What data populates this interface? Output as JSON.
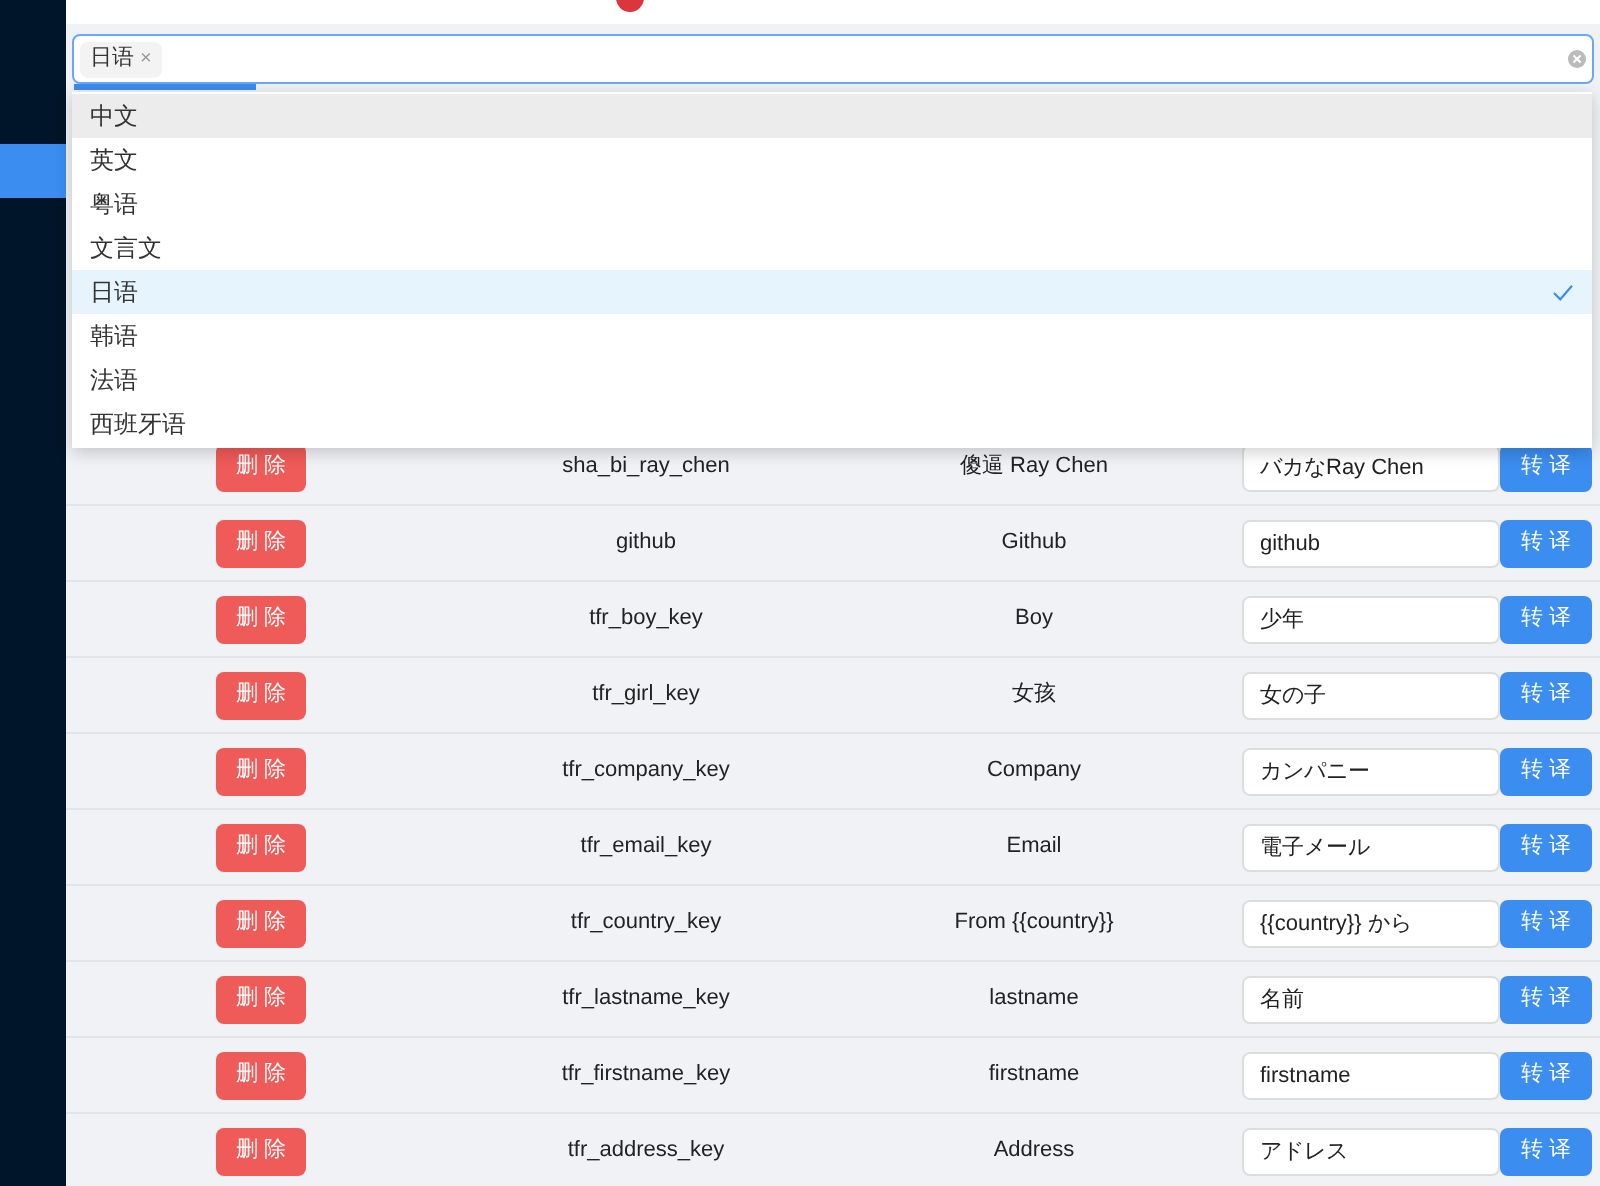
{
  "sidebar": {
    "items": [
      {
        "selected": true
      }
    ]
  },
  "language_select": {
    "tags": [
      {
        "label": "日语",
        "remove": "×"
      }
    ],
    "loading": {
      "level": 0.12
    }
  },
  "dropdown": {
    "options": [
      {
        "label": "中文",
        "selected": false,
        "hovered": true
      },
      {
        "label": "英文",
        "selected": false,
        "hovered": false
      },
      {
        "label": "粤语",
        "selected": false,
        "hovered": false
      },
      {
        "label": "文言文",
        "selected": false,
        "hovered": false
      },
      {
        "label": "日语",
        "selected": true,
        "hovered": false
      },
      {
        "label": "韩语",
        "selected": false,
        "hovered": false
      },
      {
        "label": "法语",
        "selected": false,
        "hovered": false
      },
      {
        "label": "西班牙语",
        "selected": false,
        "hovered": false
      }
    ]
  },
  "table": {
    "rows": [
      {
        "delete": "删 除",
        "key": "sha_bi_ray_chen",
        "source": "傻逼 Ray Chen",
        "translation": "バカなRay Chen",
        "translate": "转 译"
      },
      {
        "delete": "删 除",
        "key": "github",
        "source": "Github",
        "translation": "github",
        "translate": "转 译"
      },
      {
        "delete": "删 除",
        "key": "tfr_boy_key",
        "source": "Boy",
        "translation": "少年",
        "translate": "转 译"
      },
      {
        "delete": "删 除",
        "key": "tfr_girl_key",
        "source": "女孩",
        "translation": "女の子",
        "translate": "转 译"
      },
      {
        "delete": "删 除",
        "key": "tfr_company_key",
        "source": "Company",
        "translation": "カンパニー",
        "translate": "转 译"
      },
      {
        "delete": "删 除",
        "key": "tfr_email_key",
        "source": "Email",
        "translation": "電子メール",
        "translate": "转 译"
      },
      {
        "delete": "删 除",
        "key": "tfr_country_key",
        "source": "From {{country}}",
        "translation": "{{country}} から",
        "translate": "转 译"
      },
      {
        "delete": "删 除",
        "key": "tfr_lastname_key",
        "source": "lastname",
        "translation": "名前",
        "translate": "转 译"
      },
      {
        "delete": "删 除",
        "key": "tfr_firstname_key",
        "source": "firstname",
        "translation": "firstname",
        "translate": "转 译"
      },
      {
        "delete": "删 除",
        "key": "tfr_address_key",
        "source": "Address",
        "translation": "アドレス",
        "translate": "转 译"
      }
    ]
  }
}
